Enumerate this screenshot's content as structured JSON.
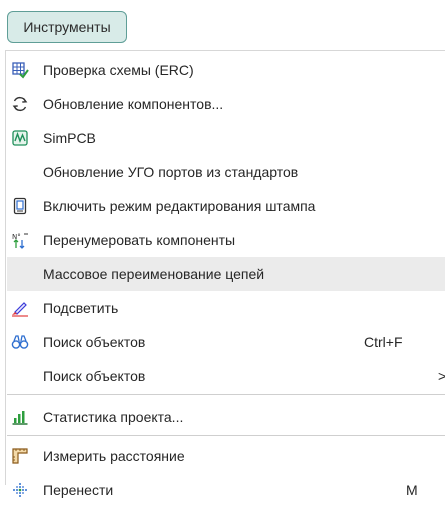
{
  "menubar": {
    "title": "Инструменты"
  },
  "menu": {
    "items": [
      {
        "label": "Проверка схемы (ERC)",
        "icon": "erc-check-icon",
        "shortcut": ""
      },
      {
        "label": "Обновление компонентов...",
        "icon": "refresh-icon",
        "shortcut": ""
      },
      {
        "label": "SimPCB",
        "icon": "simpcb-icon",
        "shortcut": ""
      },
      {
        "label": "Обновление УГО портов из стандартов",
        "icon": "",
        "shortcut": ""
      },
      {
        "label": "Включить режим редактирования штампа",
        "icon": "stamp-document-icon",
        "shortcut": ""
      },
      {
        "label": "Перенумеровать компоненты",
        "icon": "renumber-icon",
        "shortcut": ""
      },
      {
        "label": "Массовое переименование цепей",
        "icon": "",
        "shortcut": "",
        "highlighted": true
      },
      {
        "label": "Подсветить",
        "icon": "highlight-pen-icon",
        "shortcut": ""
      },
      {
        "label": "Поиск объектов",
        "icon": "binoculars-icon",
        "shortcut": "Ctrl+F"
      },
      {
        "label": "Поиск объектов",
        "icon": "",
        "shortcut": ">"
      },
      {
        "label": "Статистика проекта...",
        "icon": "bar-chart-icon",
        "shortcut": ""
      },
      {
        "label": "Измерить расстояние",
        "icon": "ruler-icon",
        "shortcut": ""
      },
      {
        "label": "Перенести",
        "icon": "move-arrows-icon",
        "shortcut": "M"
      }
    ]
  },
  "colors": {
    "button_bg": "#d8ebe8",
    "button_border": "#5f9e97",
    "highlight": "#ebebeb"
  }
}
